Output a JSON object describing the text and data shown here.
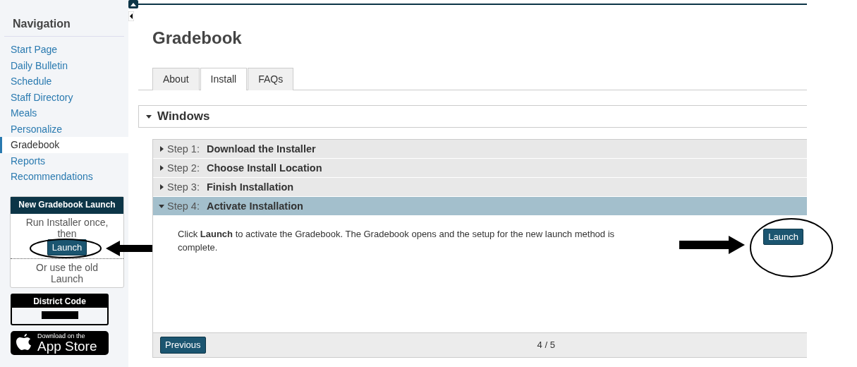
{
  "sidebar": {
    "title": "Navigation",
    "items": [
      {
        "label": "Start Page",
        "selected": false
      },
      {
        "label": "Daily Bulletin",
        "selected": false
      },
      {
        "label": "Schedule",
        "selected": false
      },
      {
        "label": "Staff Directory",
        "selected": false
      },
      {
        "label": "Meals",
        "selected": false
      },
      {
        "label": "Personalize",
        "selected": false
      },
      {
        "label": "Gradebook",
        "selected": true
      },
      {
        "label": "Reports",
        "selected": false
      },
      {
        "label": "Recommendations",
        "selected": false
      }
    ]
  },
  "launch_box": {
    "title": "New Gradebook Launch",
    "text": "Run Installer once, then",
    "button": "Launch",
    "alt_text": "Or use the old Launch"
  },
  "district_code": {
    "title": "District Code"
  },
  "app_store": {
    "small": "Download on the",
    "big": "App Store"
  },
  "page_title": "Gradebook",
  "tabs": [
    {
      "label": "About",
      "selected": false
    },
    {
      "label": "Install",
      "selected": true
    },
    {
      "label": "FAQs",
      "selected": false
    }
  ],
  "section": {
    "title": "Windows",
    "expanded": true,
    "steps": [
      {
        "label": "Step 1:",
        "title": "Download the Installer",
        "expanded": false
      },
      {
        "label": "Step 2:",
        "title": "Choose Install Location",
        "expanded": false
      },
      {
        "label": "Step 3:",
        "title": "Finish Installation",
        "expanded": false
      },
      {
        "label": "Step 4:",
        "title": "Activate Installation",
        "expanded": true
      }
    ],
    "content": "Click **Launch** to activate the Gradebook. The Gradebook opens and the setup for the new launch method is complete.",
    "button": "Launch"
  },
  "footer": {
    "button": "Previous",
    "pager": "4 / 5"
  }
}
